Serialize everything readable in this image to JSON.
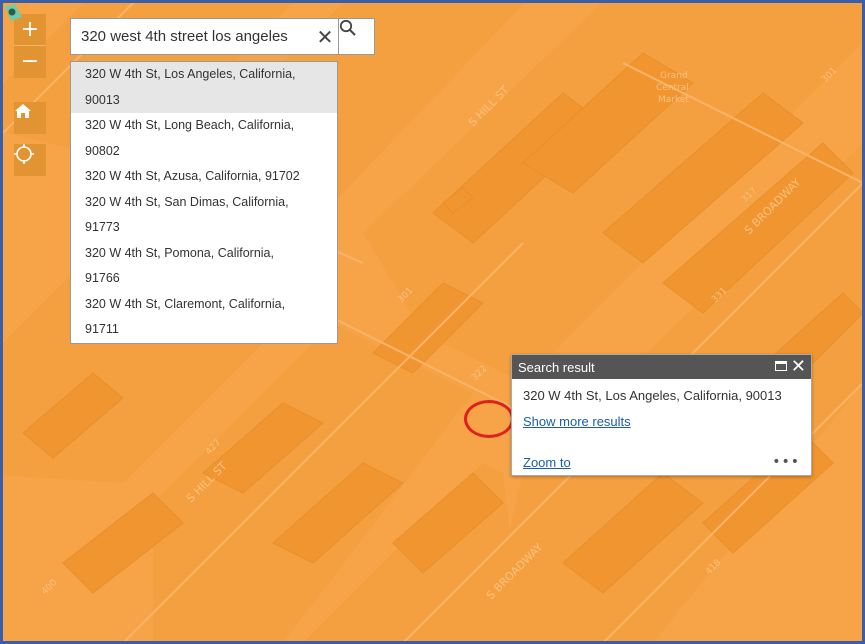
{
  "map": {
    "road_labels": {
      "hill_top": "S HILL ST",
      "hill_bottom": "S HILL ST",
      "broadway_top": "S BROADWAY",
      "broadway_bottom": "S BROADWAY",
      "num_317": "317",
      "num_331": "331",
      "num_322": "322",
      "num_427": "427",
      "num_418": "418",
      "num_400": "400",
      "num_301": "301",
      "num_301b": "301"
    },
    "poi": {
      "line1": "Grand",
      "line2": "Central",
      "line3": "Market"
    },
    "colors": {
      "base": "#f7a347",
      "block": "#f5a040",
      "building": "#f19531",
      "building_outline": "#e78f2c",
      "label": "#f8c27f"
    }
  },
  "controls": {
    "zoom_in": "+",
    "zoom_out": "−",
    "home_icon": "home-icon",
    "locate_icon": "locate-icon",
    "button_color": "#e39432"
  },
  "search": {
    "value": "320 west 4th street los angeles",
    "clear_label": "✕",
    "submit_icon": "search-icon",
    "suggestions": [
      {
        "line1": "320 W 4th St, Los Angeles, California,",
        "line2": "90013"
      },
      {
        "line1": "320 W 4th St, Long Beach, California,",
        "line2": "90802"
      },
      {
        "line1": "320 W 4th St, Azusa, California, 91702",
        "line2": ""
      },
      {
        "line1": "320 W 4th St, San Dimas, California,",
        "line2": "91773"
      },
      {
        "line1": "320 W 4th St, Pomona, California,",
        "line2": "91766"
      },
      {
        "line1": "320 W 4th St, Claremont, California,",
        "line2": "91711"
      }
    ]
  },
  "popup": {
    "title": "Search result",
    "close_label": "✕",
    "address": "320 W 4th St, Los Angeles, California, 90013",
    "more_results": "Show more results",
    "zoom_to": "Zoom to",
    "ellipsis": "•••"
  },
  "annotation": {
    "highlight_color": "#e0201d"
  }
}
